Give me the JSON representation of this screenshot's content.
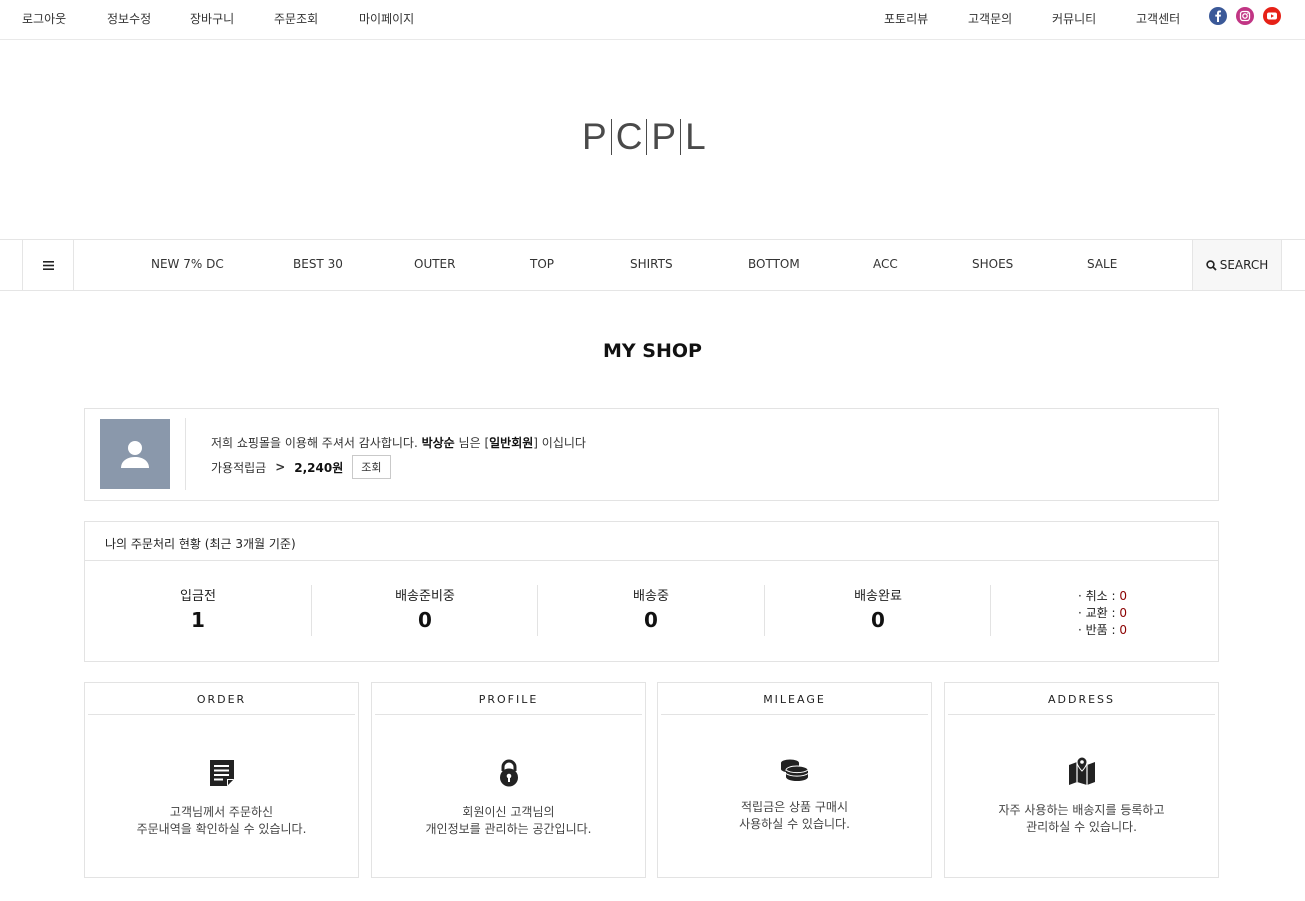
{
  "topbar": {
    "left_links": [
      "로그아웃",
      "정보수정",
      "장바구니",
      "주문조회",
      "마이페이지"
    ],
    "right_links": [
      "포토리뷰",
      "고객문의",
      "커뮤니티",
      "고객센터"
    ],
    "social_icons": [
      "facebook-icon",
      "instagram-icon",
      "youtube-icon"
    ]
  },
  "logo": {
    "letters": [
      "P",
      "C",
      "P",
      "L"
    ]
  },
  "nav": {
    "items": [
      "NEW 7% DC",
      "BEST 30",
      "OUTER",
      "TOP",
      "SHIRTS",
      "BOTTOM",
      "ACC",
      "SHOES",
      "SALE"
    ],
    "search_label": "SEARCH"
  },
  "page_title": "MY SHOP",
  "profile": {
    "greeting_prefix": "저희 쇼핑몰을 이용해 주셔서 감사합니다.",
    "user_name": "박상순",
    "greeting_mid": "님은 [",
    "grade": "일반회원",
    "greeting_suffix": "] 이십니다",
    "mileage_label": "가용적립금",
    "mileage_arrow": ">",
    "mileage_amount": "2,240원",
    "view_button": "조회"
  },
  "order_status": {
    "title": "나의 주문처리 현황 (최근 3개월 기준)",
    "columns": [
      {
        "label": "입금전",
        "count": "1"
      },
      {
        "label": "배송준비중",
        "count": "0"
      },
      {
        "label": "배송중",
        "count": "0"
      },
      {
        "label": "배송완료",
        "count": "0"
      }
    ],
    "side": [
      {
        "label": "· 취소 : ",
        "count": "0"
      },
      {
        "label": "· 교환 : ",
        "count": "0"
      },
      {
        "label": "· 반품 : ",
        "count": "0"
      }
    ]
  },
  "cards": [
    {
      "title": "ORDER",
      "icon": "document-icon",
      "line1": "고객님께서 주문하신",
      "line2": "주문내역을 확인하실 수 있습니다."
    },
    {
      "title": "PROFILE",
      "icon": "lock-icon",
      "line1": "회원이신 고객님의",
      "line2": "개인정보를 관리하는 공간입니다."
    },
    {
      "title": "MILEAGE",
      "icon": "coins-icon",
      "line1": "적립금은 상품 구매시",
      "line2": "사용하실 수 있습니다."
    },
    {
      "title": "ADDRESS",
      "icon": "map-icon",
      "line1": "자주 사용하는 배송지를 등록하고",
      "line2": "관리하실 수 있습니다."
    }
  ],
  "colors": {
    "avatar_bg": "#8a98ab",
    "accent_red": "#8b0000",
    "facebook": "#3b5998",
    "instagram": "#c13584",
    "youtube": "#e62117"
  }
}
